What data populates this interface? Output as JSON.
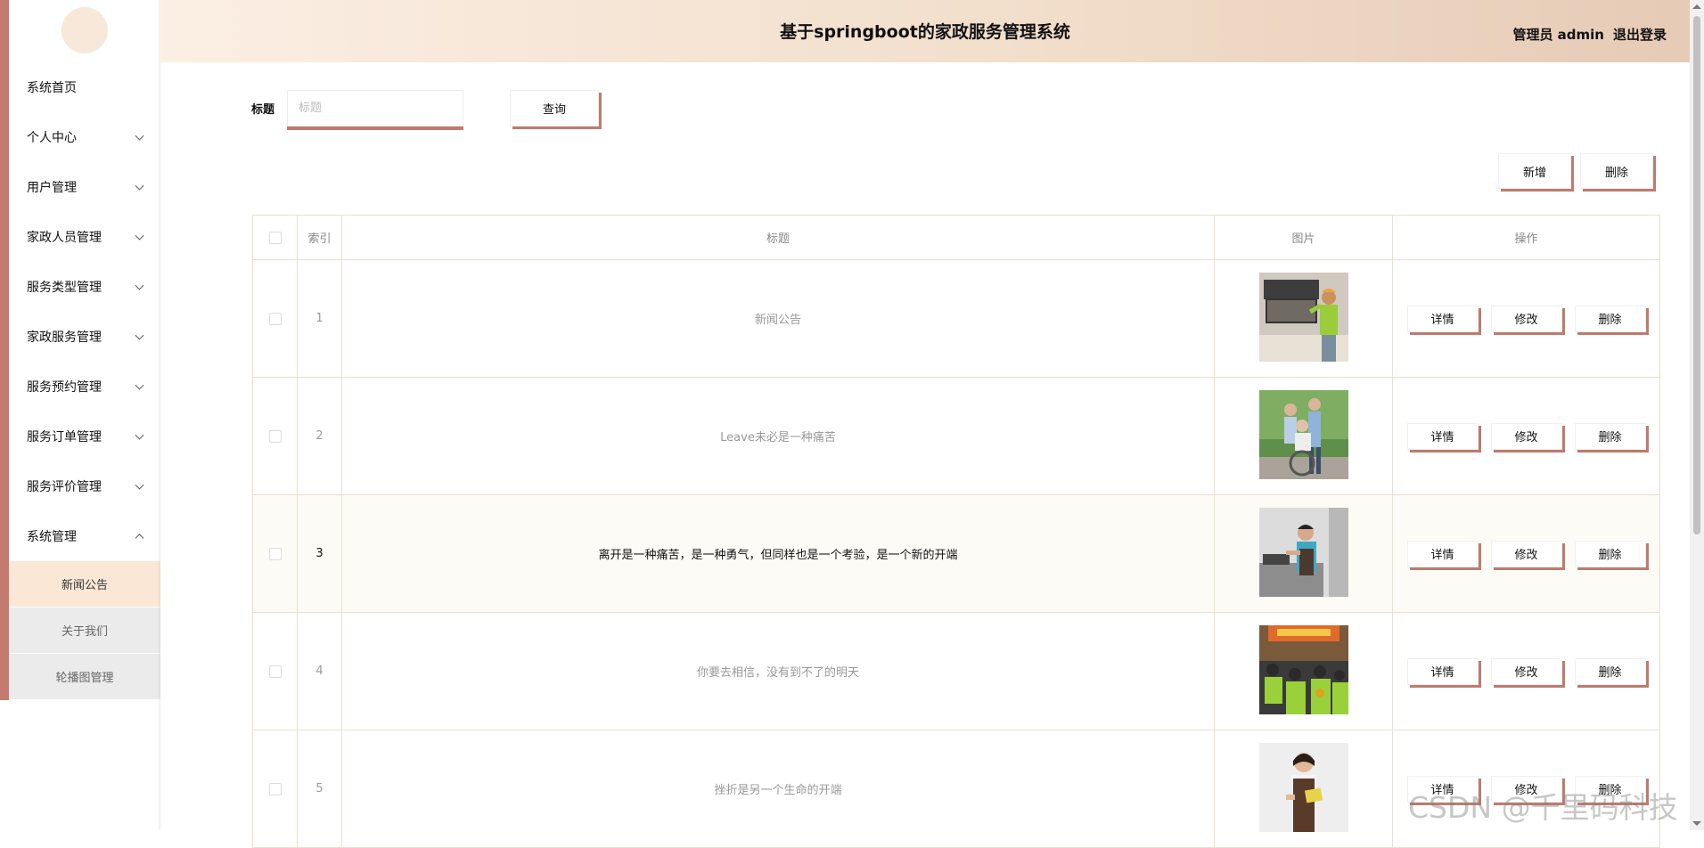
{
  "header": {
    "title": "基于springboot的家政服务管理系统",
    "user_label": "管理员 admin",
    "logout_label": "退出登录"
  },
  "sidebar": {
    "items": [
      {
        "label": "系统首页",
        "has_arrow": false
      },
      {
        "label": "个人中心",
        "has_arrow": true
      },
      {
        "label": "用户管理",
        "has_arrow": true
      },
      {
        "label": "家政人员管理",
        "has_arrow": true
      },
      {
        "label": "服务类型管理",
        "has_arrow": true
      },
      {
        "label": "家政服务管理",
        "has_arrow": true
      },
      {
        "label": "服务预约管理",
        "has_arrow": true
      },
      {
        "label": "服务订单管理",
        "has_arrow": true
      },
      {
        "label": "服务评价管理",
        "has_arrow": true
      },
      {
        "label": "系统管理",
        "has_arrow": true,
        "expanded": true
      }
    ],
    "subitems": [
      {
        "label": "新闻公告",
        "active": true
      },
      {
        "label": "关于我们",
        "active": false
      },
      {
        "label": "轮播图管理",
        "active": false
      }
    ]
  },
  "search": {
    "label": "标题",
    "placeholder": "标题",
    "value": "",
    "button_label": "查询"
  },
  "toolbar": {
    "add_label": "新增",
    "delete_label": "删除"
  },
  "table": {
    "headers": {
      "index": "索引",
      "title": "标题",
      "image": "图片",
      "ops": "操作"
    },
    "op_labels": {
      "detail": "详情",
      "edit": "修改",
      "delete": "删除"
    },
    "rows": [
      {
        "index": "1",
        "title": "新闻公告",
        "image": "worker-cleaning-cabinet",
        "highlight": false
      },
      {
        "index": "2",
        "title": "Leave未必是一种痛苦",
        "image": "caregiver-with-wheelchair",
        "highlight": false
      },
      {
        "index": "3",
        "title": "离开是一种痛苦，是一种勇气，但同样也是一个考验，是一个新的开端",
        "image": "cook-in-kitchen",
        "highlight": true
      },
      {
        "index": "4",
        "title": "你要去相信，没有到不了的明天",
        "image": "team-in-green-uniforms",
        "highlight": false
      },
      {
        "index": "5",
        "title": "挫折是另一个生命的开端",
        "image": "maid-holding-cloth",
        "highlight": false
      }
    ]
  },
  "watermark": "CSDN @千里码科技",
  "colors": {
    "accent": "#bd7b6e",
    "rail": "#c47a6e",
    "active_sub": "#fbe7d6"
  }
}
